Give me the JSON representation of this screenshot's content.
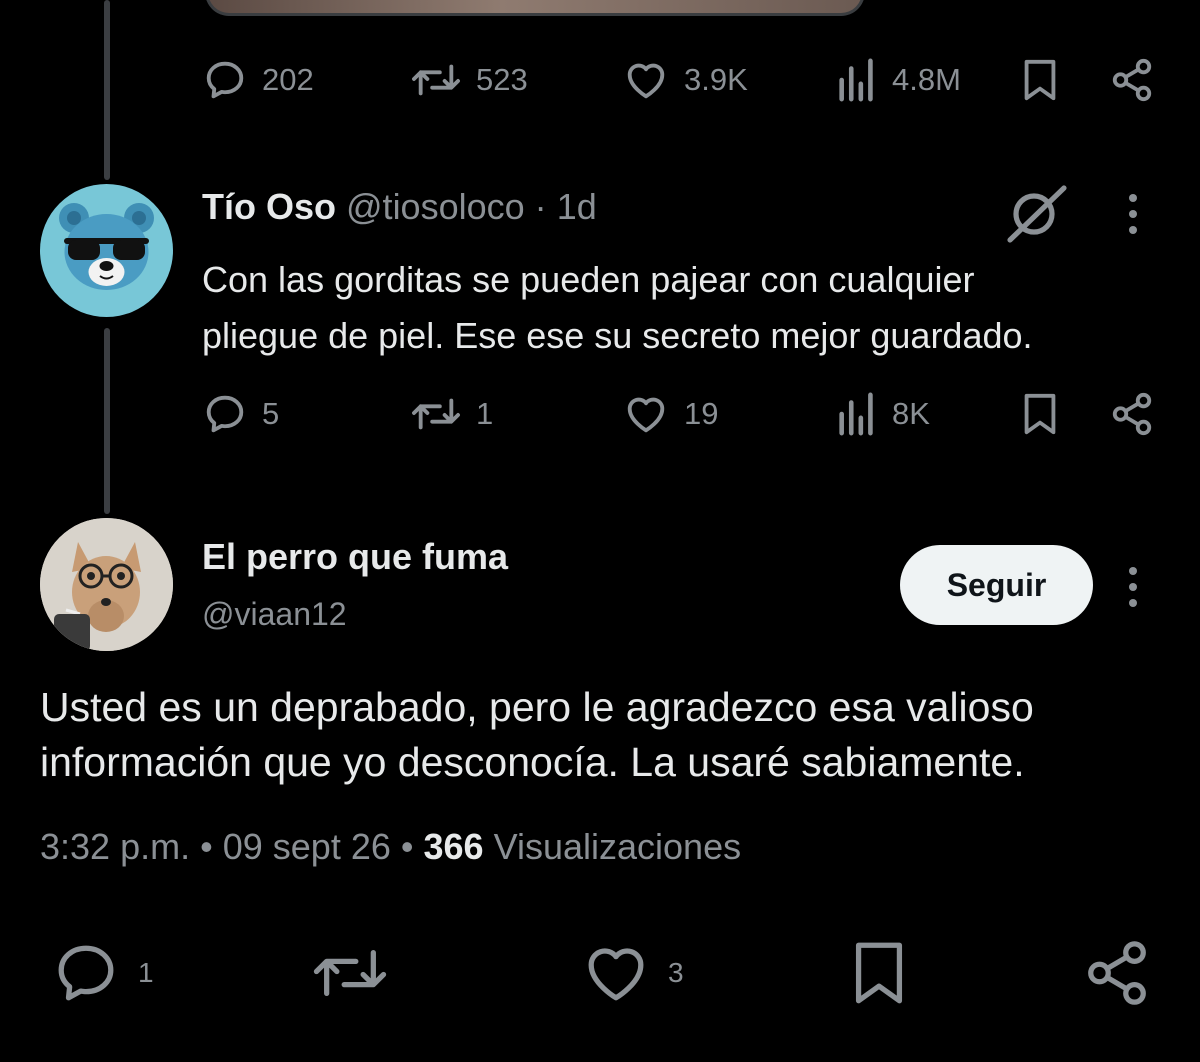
{
  "prev_tweet": {
    "actions": {
      "replies": "202",
      "reposts": "523",
      "likes": "3.9K",
      "views": "4.8M"
    }
  },
  "reply_tweet": {
    "display_name": "Tío Oso",
    "handle": "@tiosoloco",
    "separator": "·",
    "age": "1d",
    "text_line1": "Con las gorditas se pueden pajear con cualquier",
    "text_line2": "pliegue de piel. Ese ese su secreto mejor guardado.",
    "actions": {
      "replies": "5",
      "reposts": "1",
      "likes": "19",
      "views": "8K"
    }
  },
  "main_tweet": {
    "display_name": "El perro que fuma",
    "handle": "@viaan12",
    "follow_label": "Seguir",
    "text_line1": "Usted es un deprabado, pero le agradezco esa valioso",
    "text_line2": "información que yo desconocía. La usaré sabiamente.",
    "time": "3:32 p.m.",
    "dot": "•",
    "date": "09 sept 26",
    "views_count": "366",
    "views_label": "Visualizaciones",
    "actions": {
      "replies": "1",
      "likes": "3"
    }
  },
  "colors": {
    "background": "#000000",
    "primary_text": "#e7e9ea",
    "secondary_text": "#8b9095",
    "follow_button_bg": "#eff3f4"
  },
  "icons": [
    "reply-icon",
    "repost-icon",
    "like-icon",
    "views-icon",
    "bookmark-icon",
    "share-icon",
    "grok-icon",
    "more-icon"
  ]
}
